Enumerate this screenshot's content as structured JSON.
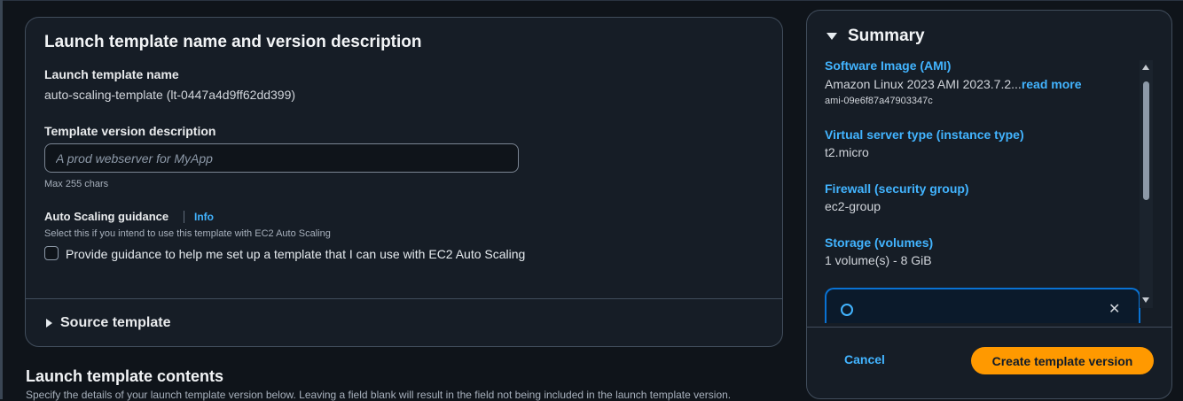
{
  "template_panel": {
    "title": "Launch template name and version description",
    "name_label": "Launch template name",
    "name_value": "auto-scaling-template (lt-0447a4d9ff62dd399)",
    "version_desc_label": "Template version description",
    "version_desc_placeholder": "A prod webserver for MyApp",
    "version_desc_value": "",
    "max_chars_hint": "Max 255 chars",
    "guidance_label": "Auto Scaling guidance",
    "info_link": "Info",
    "guidance_desc": "Select this if you intend to use this template with EC2 Auto Scaling",
    "guidance_checkbox_label": "Provide guidance to help me set up a template that I can use with EC2 Auto Scaling",
    "guidance_checked": false,
    "source_template_label": "Source template"
  },
  "contents_section": {
    "title": "Launch template contents",
    "description": "Specify the details of your launch template version below. Leaving a field blank will result in the field not being included in the launch template version."
  },
  "summary": {
    "title": "Summary",
    "items": [
      {
        "label": "Software Image (AMI)",
        "value": "Amazon Linux 2023 AMI 2023.7.2...",
        "link": "read more",
        "sub": "ami-09e6f87a47903347c"
      },
      {
        "label": "Virtual server type (instance type)",
        "value": "t2.micro"
      },
      {
        "label": "Firewall (security group)",
        "value": "ec2-group"
      },
      {
        "label": "Storage (volumes)",
        "value": "1 volume(s) - 8 GiB"
      }
    ],
    "cancel_label": "Cancel",
    "create_label": "Create template version"
  },
  "colors": {
    "background": "#0f141a",
    "panel": "#161d26",
    "link": "#42b4ff",
    "primary_button": "#ff9900",
    "border": "#414d5c"
  },
  "icons": [
    "caret-right-icon",
    "caret-down-icon",
    "info-circle-icon",
    "close-icon",
    "scroll-up-icon",
    "scroll-down-icon"
  ]
}
